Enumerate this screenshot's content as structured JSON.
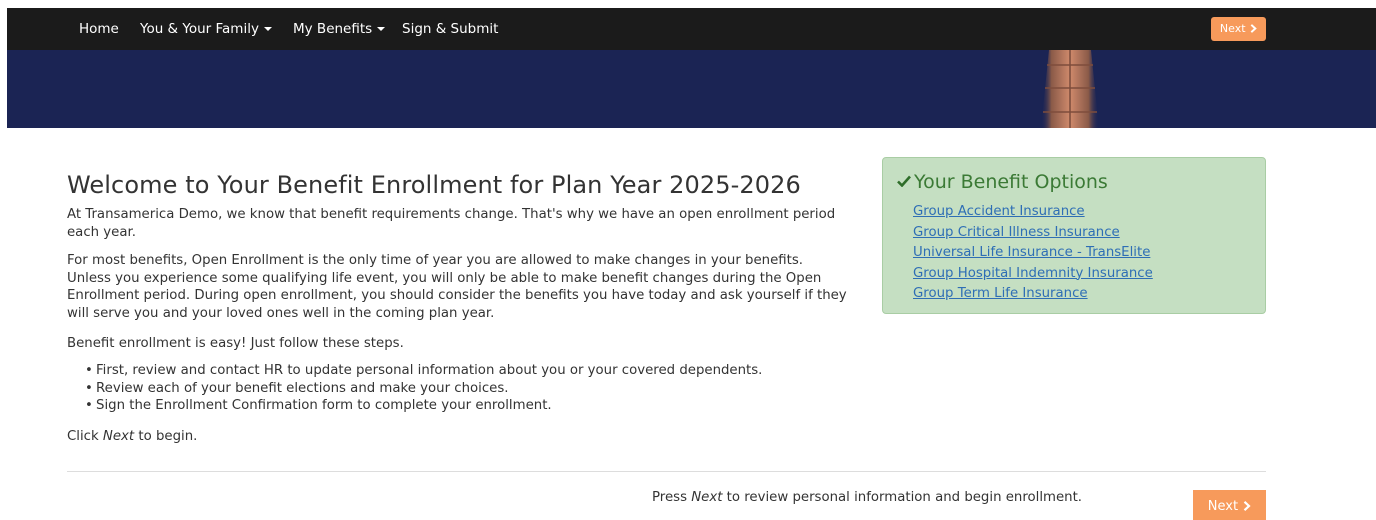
{
  "nav": {
    "items": [
      {
        "label": "Home",
        "dropdown": false
      },
      {
        "label": "You & Your Family",
        "dropdown": true
      },
      {
        "label": "My Benefits",
        "dropdown": true
      },
      {
        "label": "Sign & Submit",
        "dropdown": false
      }
    ],
    "next_label": "Next"
  },
  "main": {
    "title": "Welcome to Your Benefit Enrollment for Plan Year 2025-2026",
    "intro": "At Transamerica Demo, we know that benefit requirements change. That's why we have an open enrollment period each year.",
    "para2": "For most benefits, Open Enrollment is the only time of year you are allowed to make changes in your benefits. Unless you experience some qualifying life event, you will only be able to make benefit changes during the Open Enrollment period. During open enrollment, you should consider the benefits you have today and ask yourself if they will serve you and your loved ones well in the coming plan year.",
    "easy": "Benefit enrollment is easy! Just follow these steps.",
    "steps": [
      "First, review and contact HR to update personal information about you or your covered dependents.",
      "Review each of your benefit elections and make your choices.",
      "Sign the Enrollment Confirmation form to complete your enrollment."
    ],
    "click_prefix": "Click ",
    "click_emph": "Next",
    "click_suffix": " to begin."
  },
  "footer": {
    "text_prefix": "Press ",
    "text_emph": "Next",
    "text_suffix": " to review personal information and begin enrollment.",
    "next_label": "Next"
  },
  "benefit_options": {
    "title": "Your Benefit Options",
    "links": [
      "Group Accident Insurance",
      "Group Critical Illness Insurance",
      "Universal Life Insurance - TransElite",
      "Group Hospital Indemnity Insurance",
      "Group Term Life Insurance"
    ]
  },
  "colors": {
    "navbar": "#1b1b1b",
    "banner": "#1b2454",
    "accent_orange": "#f79a5b",
    "panel_bg": "#c5dfc2",
    "panel_title": "#3b7a35",
    "link": "#2e6eb5"
  },
  "icons": {
    "nav_dropdown": "caret-down-icon",
    "next": "chevron-right-icon",
    "options_title": "check-icon"
  }
}
